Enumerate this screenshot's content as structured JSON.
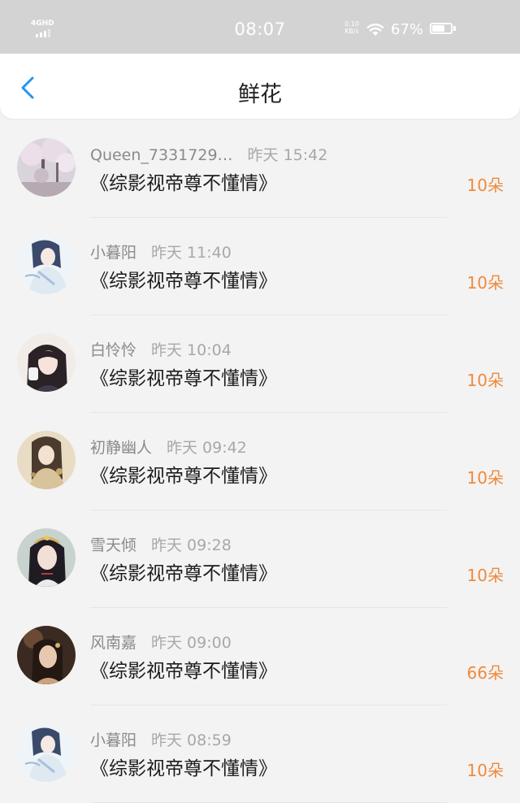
{
  "status_bar": {
    "network": "4GHD",
    "time": "08:07",
    "speed_value": "0.10",
    "speed_unit": "KB/s",
    "battery": "67%",
    "battery_level": 0.67
  },
  "header": {
    "title": "鲜花",
    "back_icon": "chevron-left-icon"
  },
  "colors": {
    "accent": "#2196f3",
    "amount": "#f08a3c",
    "status_bar_bg": "#d3d3d3",
    "page_bg": "#f3f3f3"
  },
  "items": [
    {
      "user": "Queen_7331729…",
      "time": "昨天 15:42",
      "book": "《综影视帝尊不懂情》",
      "amount": "10朵"
    },
    {
      "user": "小暮阳",
      "time": "昨天 11:40",
      "book": "《综影视帝尊不懂情》",
      "amount": "10朵"
    },
    {
      "user": "白怜怜",
      "time": "昨天 10:04",
      "book": "《综影视帝尊不懂情》",
      "amount": "10朵"
    },
    {
      "user": "初静幽人",
      "time": "昨天 09:42",
      "book": "《综影视帝尊不懂情》",
      "amount": "10朵"
    },
    {
      "user": "雪天倾",
      "time": "昨天 09:28",
      "book": "《综影视帝尊不懂情》",
      "amount": "10朵"
    },
    {
      "user": "风南嘉",
      "time": "昨天 09:00",
      "book": "《综影视帝尊不懂情》",
      "amount": "66朵"
    },
    {
      "user": "小暮阳",
      "time": "昨天 08:59",
      "book": "《综影视帝尊不懂情》",
      "amount": "10朵"
    }
  ]
}
